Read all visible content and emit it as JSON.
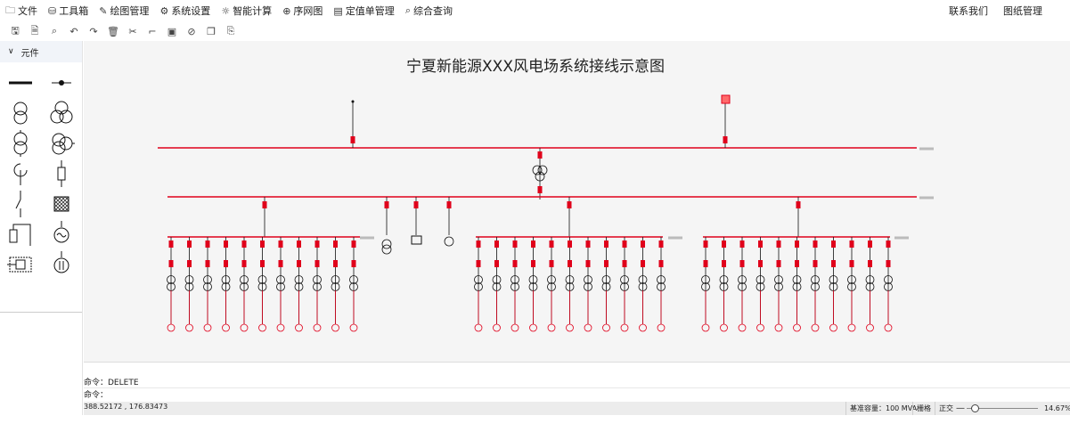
{
  "menu": {
    "items": [
      {
        "label": "文件",
        "icon": "folder-icon",
        "glyph": "🗀"
      },
      {
        "label": "工具箱",
        "icon": "toolbox-icon",
        "glyph": "⛁"
      },
      {
        "label": "绘图管理",
        "icon": "paint-icon",
        "glyph": "✎"
      },
      {
        "label": "系统设置",
        "icon": "gear-icon",
        "glyph": "⚙"
      },
      {
        "label": "智能计算",
        "icon": "bulb-icon",
        "glyph": "☼"
      },
      {
        "label": "序网图",
        "icon": "network-icon",
        "glyph": "⊕"
      },
      {
        "label": "定值单管理",
        "icon": "document-icon",
        "glyph": "▤"
      },
      {
        "label": "综合查询",
        "icon": "query-icon",
        "glyph": "⌕"
      }
    ],
    "contact": "联系我们",
    "drawings": "图纸管理"
  },
  "toolbar": {
    "buttons": [
      {
        "name": "save-icon",
        "glyph": "🖫"
      },
      {
        "name": "save-as-icon",
        "glyph": "🗎"
      },
      {
        "name": "zoom-icon",
        "glyph": "⌕"
      },
      {
        "name": "undo-icon",
        "glyph": "↶"
      },
      {
        "name": "redo-icon",
        "glyph": "↷"
      },
      {
        "name": "delete-icon",
        "glyph": "🗑"
      },
      {
        "name": "tools-icon",
        "glyph": "✂"
      },
      {
        "name": "connect-icon",
        "glyph": "⌐"
      },
      {
        "name": "image-icon",
        "glyph": "▣"
      },
      {
        "name": "rotate-icon",
        "glyph": "⊘"
      },
      {
        "name": "copy-icon",
        "glyph": "❐"
      },
      {
        "name": "paste-icon",
        "glyph": "⎘"
      }
    ]
  },
  "sidebar": {
    "title": "元件"
  },
  "diagram": {
    "title": "宁夏新能源XXX风电场系统接线示意图"
  },
  "command": {
    "line1": "命令：DELETE",
    "line2_label": "命令：",
    "line2_value": ""
  },
  "status": {
    "coords": "388.52172 , 176.83473",
    "base_capacity": "基准容量：100 MVA",
    "grid": "栅格",
    "ortho": "正交",
    "zoom": "14.67%",
    "zoom_minus": "—"
  },
  "colors": {
    "accent": "#e0001b",
    "line": "#111111"
  }
}
